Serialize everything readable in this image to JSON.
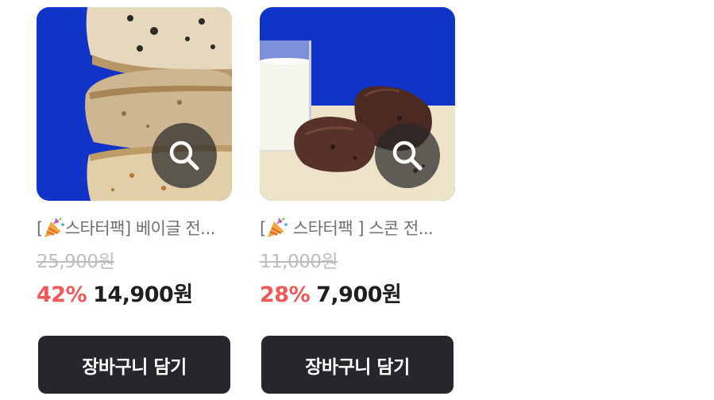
{
  "products": [
    {
      "title_prefix": "[",
      "title_rest": "스타터팩] 베이글 전...",
      "original_price": "25,900원",
      "discount": "42%",
      "sale_price": "14,900원",
      "cart_label": "장바구니 담기",
      "thumbnail_icon": "bagel-stack-photo"
    },
    {
      "title_prefix": "[",
      "title_rest": " 스타터팩 ] 스콘 전...",
      "original_price": "11,000원",
      "discount": "28%",
      "sale_price": "7,900원",
      "cart_label": "장바구니 담기",
      "thumbnail_icon": "chocolate-scone-photo"
    }
  ],
  "colors": {
    "discount": "#f0595a",
    "button_bg": "#26272b",
    "strike_price": "#bdbdbd",
    "title": "#6f6f6f",
    "photo_blue": "#1034c8"
  }
}
